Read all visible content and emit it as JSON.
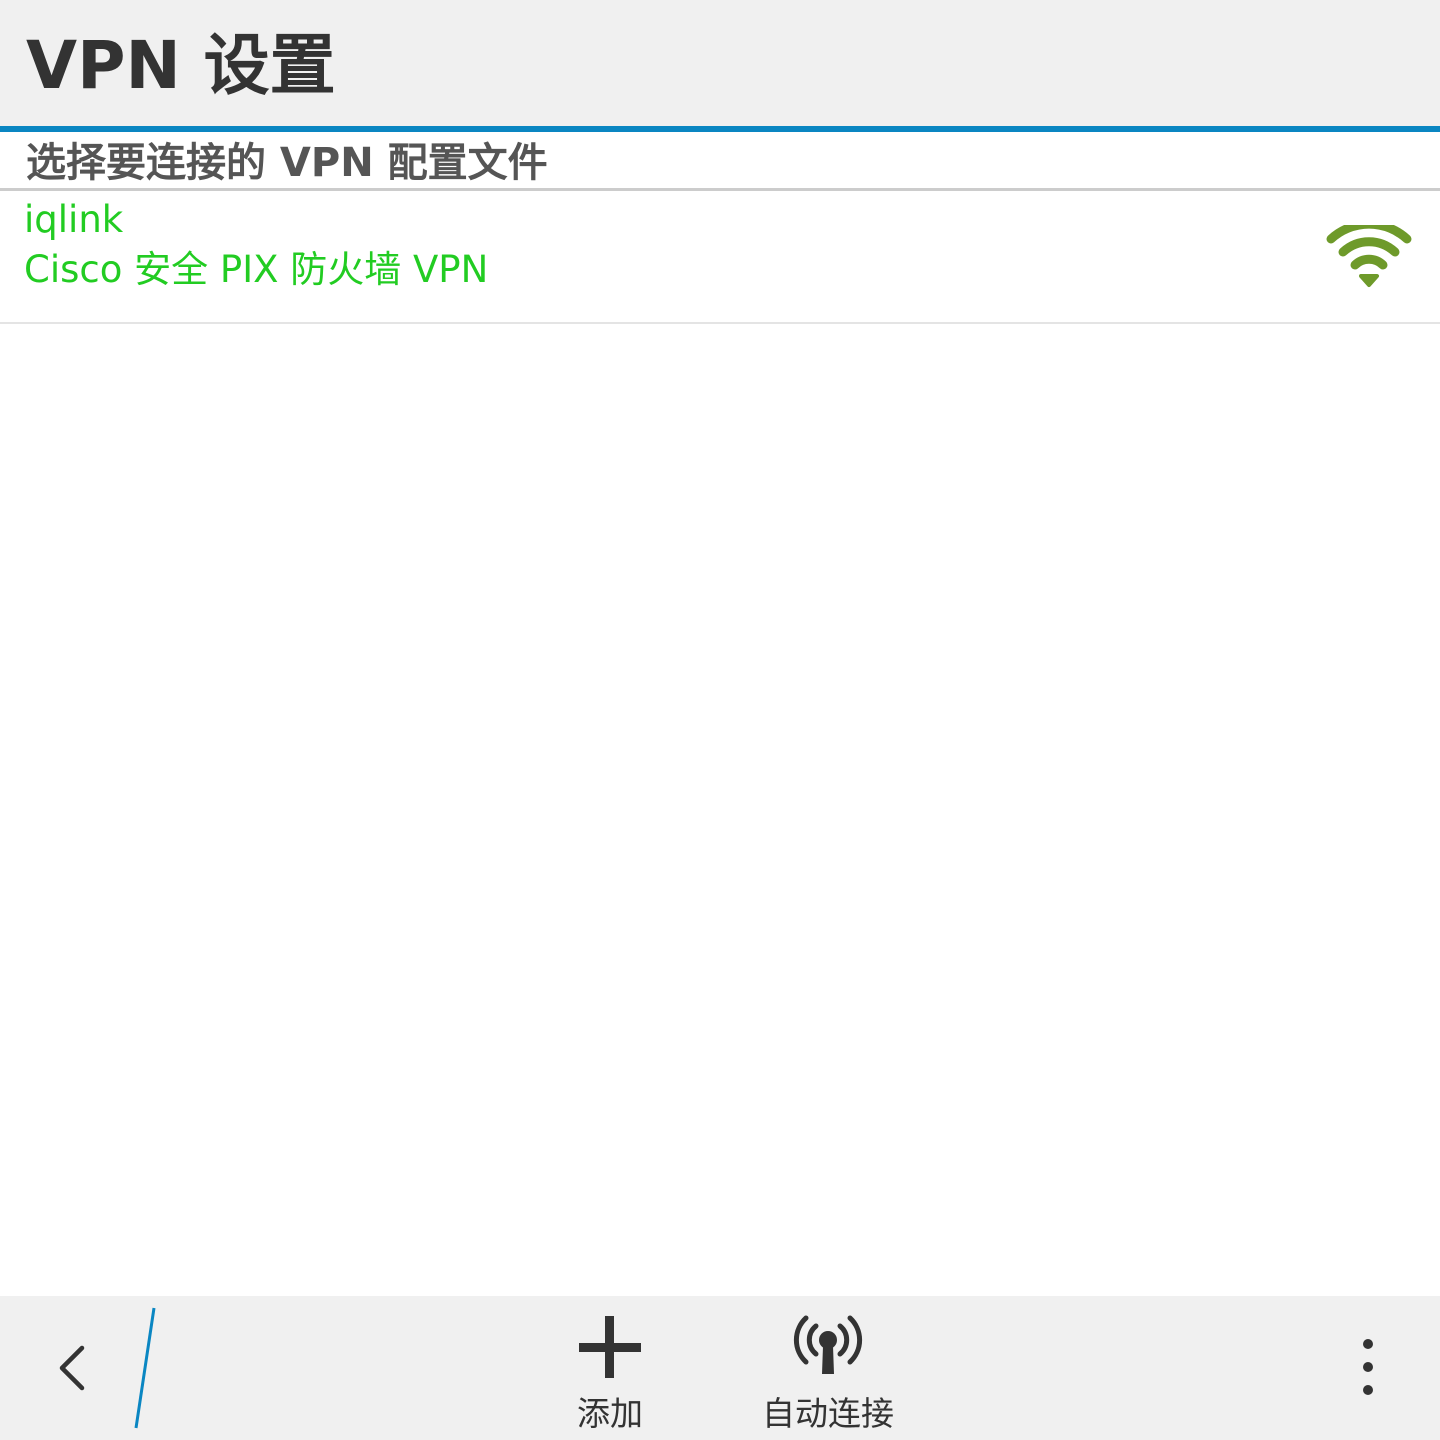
{
  "header": {
    "title": "VPN 设置"
  },
  "section": {
    "label": "选择要连接的 VPN 配置文件"
  },
  "profiles": [
    {
      "name": "iqlink",
      "type": "Cisco 安全 PIX 防火墙 VPN",
      "status_icon": "wifi-signal-icon",
      "text_color": "#22cc22",
      "icon_color": "#6e9a2a"
    }
  ],
  "toolbar": {
    "back_icon": "chevron-left-icon",
    "add_label": "添加",
    "add_icon": "plus-icon",
    "auto_connect_label": "自动连接",
    "auto_connect_icon": "antenna-icon",
    "more_icon": "vertical-ellipsis-icon"
  },
  "colors": {
    "accent": "#0a86c2",
    "header_bg": "#f0f0f0",
    "title_text": "#333333"
  }
}
